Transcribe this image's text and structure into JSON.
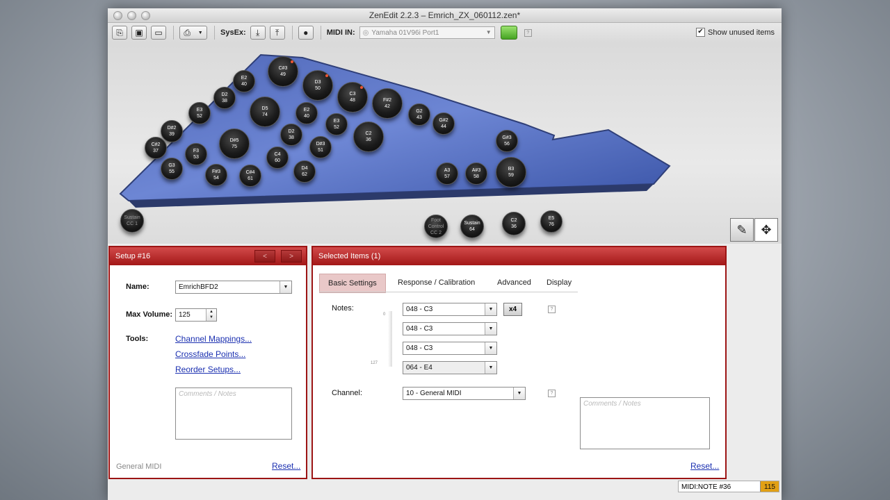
{
  "window": {
    "title": "ZenEdit 2.2.3 – Emrich_ZX_060112.zen*"
  },
  "toolbar": {
    "sysex_label": "SysEx:",
    "midi_in_label": "MIDI IN:",
    "midi_in_value": "Yamaha 01V96i Port1",
    "show_unused_label": "Show unused items",
    "show_unused_checked": true,
    "help_glyph": "?"
  },
  "pads": [
    {
      "note": "C#3",
      "num": "49",
      "red": true
    },
    {
      "note": "E2",
      "num": "40"
    },
    {
      "note": "D3",
      "num": "50",
      "red": true
    },
    {
      "note": "C3",
      "num": "48",
      "red": true
    },
    {
      "note": "F#2",
      "num": "42"
    },
    {
      "note": "D2",
      "num": "38"
    },
    {
      "note": "E3",
      "num": "52"
    },
    {
      "note": "D5",
      "num": "74"
    },
    {
      "note": "E2",
      "num": "40"
    },
    {
      "note": "G2",
      "num": "43"
    },
    {
      "note": "G#2",
      "num": "44"
    },
    {
      "note": "D#2",
      "num": "39"
    },
    {
      "note": "E3",
      "num": "52"
    },
    {
      "note": "C2",
      "num": "36"
    },
    {
      "note": "D2",
      "num": "38"
    },
    {
      "note": "C#2",
      "num": "37"
    },
    {
      "note": "D#5",
      "num": "75"
    },
    {
      "note": "D#3",
      "num": "51"
    },
    {
      "note": "G#3",
      "num": "56"
    },
    {
      "note": "F3",
      "num": "53"
    },
    {
      "note": "C4",
      "num": "60"
    },
    {
      "note": "G3",
      "num": "55"
    },
    {
      "note": "D4",
      "num": "62"
    },
    {
      "note": "F#3",
      "num": "54"
    },
    {
      "note": "C#4",
      "num": "61"
    },
    {
      "note": "A3",
      "num": "57"
    },
    {
      "note": "A#3",
      "num": "58"
    },
    {
      "note": "B3",
      "num": "59"
    },
    {
      "note": "Sustain",
      "num": "CC 1",
      "dim": true
    },
    {
      "note": "Foot Control",
      "num": "CC 2",
      "dim": true
    },
    {
      "note": "Sustain",
      "num": "64"
    },
    {
      "note": "C2",
      "num": "36"
    },
    {
      "note": "E5",
      "num": "76"
    }
  ],
  "setup_panel": {
    "title": "Setup #16",
    "prev": "<",
    "next": ">",
    "name_label": "Name:",
    "name_value": "EmrichBFD2",
    "maxvol_label": "Max Volume:",
    "maxvol_value": "125",
    "tools_label": "Tools:",
    "tools": [
      "Channel Mappings...",
      "Crossfade Points...",
      "Reorder Setups..."
    ],
    "comments_placeholder": "Comments / Notes",
    "footer_label": "General MIDI",
    "reset": "Reset..."
  },
  "selected_panel": {
    "title": "Selected Items (1)",
    "tabs": [
      "Basic Settings",
      "Response / Calibration",
      "Advanced",
      "Display"
    ],
    "active_tab": 0,
    "notes_label": "Notes:",
    "notes": [
      "048 - C3",
      "048 - C3",
      "048 - C3",
      "064 - E4"
    ],
    "x4_label": "x4",
    "scale_top": "0",
    "scale_bottom": "127",
    "channel_label": "Channel:",
    "channel_value": "10 - General MIDI",
    "comments_placeholder": "Comments / Notes",
    "reset": "Reset..."
  },
  "status": {
    "label": "MIDI:NOTE #36",
    "value": "115"
  },
  "icons": [
    "new-icon",
    "save-icon",
    "folder-icon",
    "print-icon",
    "import-icon",
    "export-icon",
    "stop-icon",
    "pencil-icon",
    "move-icon"
  ]
}
